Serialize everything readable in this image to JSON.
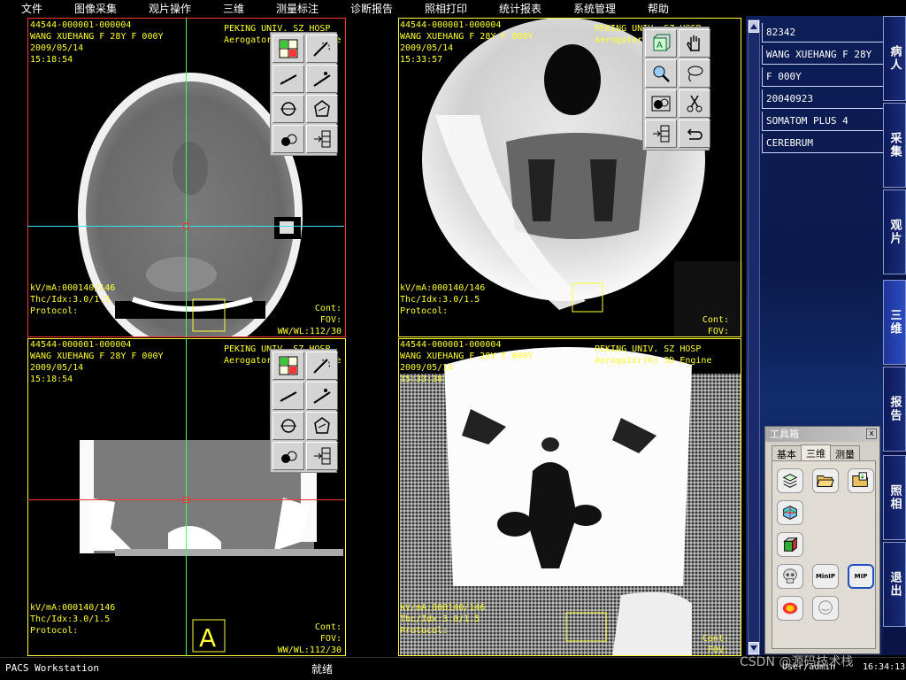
{
  "menu": [
    "文件",
    "图像采集",
    "观片操作",
    "三维",
    "测量标注",
    "诊断报告",
    "照相打印",
    "统计报表",
    "系统管理",
    "帮助"
  ],
  "viewports": [
    {
      "id": "top-left",
      "line1": "44544-000001-000004",
      "line2": "WANG XUEHANG F 28Y F 000Y",
      "line3": "2009/05/14",
      "line4": "15:18:54",
      "hosp1": "PEKING UNIV. SZ HOSP",
      "hosp2": "Aerogator(R) 3D Engine",
      "kv": "kV/mA:000140/146",
      "thc": "Thc/Idx:3.0/1.5",
      "protocol": "Protocol:",
      "cont": "Cont:",
      "fov": "FOV:",
      "wwwl": "WW/WL:112/30"
    },
    {
      "id": "top-right",
      "line1": "44544-000001-000004",
      "line2": "WANG XUEHANG F 28Y F 000Y",
      "line3": "2009/05/14",
      "line4": "15:33:57",
      "hosp1": "PEKING UNIV. SZ HOSP",
      "hosp2": "Aerogator(R) 3D Engine",
      "kv": "kV/mA:000140/146",
      "thc": "Thc/Idx:3.0/1.5",
      "protocol": "Protocol:",
      "cont": "Cont:",
      "fov": "FOV:",
      "wwwl": ""
    },
    {
      "id": "bottom-left",
      "line1": "44544-000001-000004",
      "line2": "WANG XUEHANG F 28Y F 000Y",
      "line3": "2009/05/14",
      "line4": "15:18:54",
      "hosp1": "PEKING UNIV. SZ HOSP",
      "hosp2": "Aerogator(R) 3D Engine",
      "kv": "kV/mA:000140/146",
      "thc": "Thc/Idx:3.0/1.5",
      "protocol": "Protocol:",
      "cont": "Cont:",
      "fov": "FOV:",
      "wwwl": "WW/WL:112/30"
    },
    {
      "id": "bottom-right",
      "line1": "44544-000001-000004",
      "line2": "WANG XUEHANG F 28Y F 000Y",
      "line3": "2009/05/14",
      "line4": "15:33:38",
      "hosp1": "PEKING UNIV. SZ HOSP",
      "hosp2": "Aerogator(R) 3D Engine",
      "kv": "kV/mA:000140/146",
      "thc": "Thc/Idx:3.0/1.5",
      "protocol": "Protocol:",
      "cont": "Cont:",
      "fov": "FOV:",
      "wwwl": ""
    }
  ],
  "orientation_marker": "A",
  "patient": {
    "id": "82342",
    "name": "WANG XUEHANG F 28Y",
    "sex_age": "F 000Y",
    "date": "20040923",
    "device": "SOMATOM PLUS 4",
    "body_part": "CEREBRUM"
  },
  "side_tabs": [
    "病人",
    "采集",
    "观片",
    "三维",
    "报告",
    "照相",
    "退出"
  ],
  "active_side_tab": "三维",
  "toolbox": {
    "title": "工具箱",
    "close": "x",
    "tabs": [
      "基本",
      "三维",
      "测量"
    ],
    "active_tab": "三维",
    "minip_label": "MinIP",
    "mip_label": "MIP"
  },
  "status": {
    "app": "PACS Workstation",
    "message": "就绪",
    "user": "User/admin",
    "time": "16:34:13"
  },
  "watermark": "CSDN @源码技术栈",
  "colors": {
    "overlay_text": "#ffff33",
    "crosshair_vertical": "#33ff66",
    "crosshair_horizontal_cyan": "#33e6ff",
    "crosshair_horizontal_red": "#ff3333",
    "viewport_border_active": "#ff3333",
    "viewport_border": "#ffff33",
    "panel_blue": "#0d1e58"
  }
}
